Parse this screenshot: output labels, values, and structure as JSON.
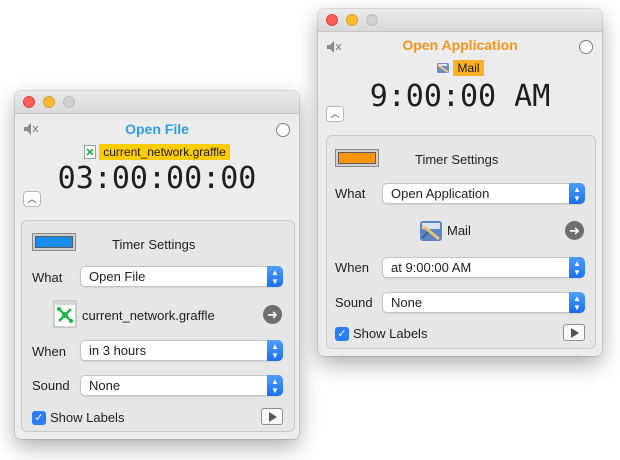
{
  "right_window": {
    "title": "Open Application",
    "title_color": "#f7941d",
    "tag_label": "Mail",
    "tag_color": "#fcb024",
    "time": "9:00:00 AM",
    "panel_title": "Timer Settings",
    "swatch_color": "#ff9500",
    "what_label": "What",
    "what_value": "Open Application",
    "target_name": "Mail",
    "when_label": "When",
    "when_value": "at 9:00:00 AM",
    "sound_label": "Sound",
    "sound_value": "None",
    "show_labels": "Show Labels",
    "icons": [
      "mute-icon",
      "mail-app-icon",
      "go-arrow-icon",
      "play-icon"
    ]
  },
  "left_window": {
    "title": "Open File",
    "title_color": "#2f9de0",
    "tag_label": "current_network.graffle",
    "tag_color": "#ffcc00",
    "time": "03:00:00:00",
    "panel_title": "Timer Settings",
    "swatch_color": "#1a8cf0",
    "what_label": "What",
    "what_value": "Open File",
    "target_name": "current_network.graffle",
    "when_label": "When",
    "when_value": "in 3 hours",
    "sound_label": "Sound",
    "sound_value": "None",
    "show_labels": "Show Labels",
    "icons": [
      "mute-icon",
      "graffle-file-icon",
      "go-arrow-icon",
      "play-icon"
    ]
  }
}
